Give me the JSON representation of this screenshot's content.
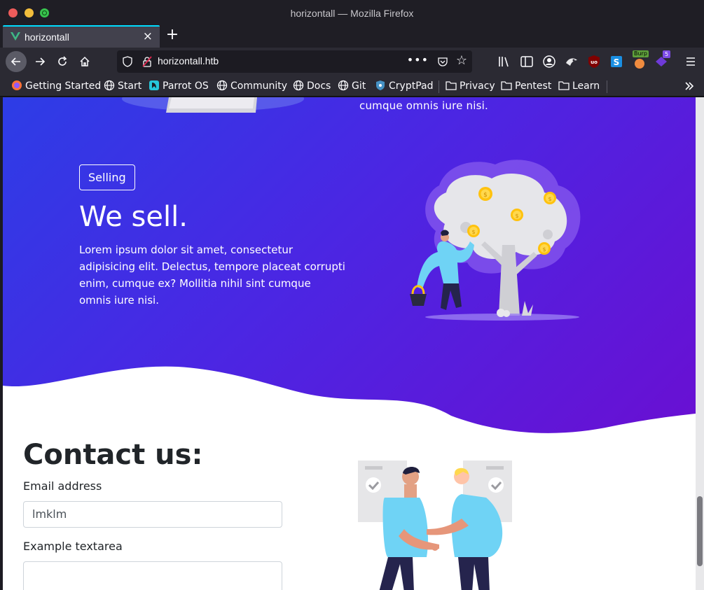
{
  "window": {
    "title": "horizontall — Mozilla Firefox"
  },
  "tab": {
    "label": "horizontall",
    "close": "×",
    "new_tab": "+"
  },
  "navbar": {
    "url": "horizontall.htb",
    "more": "•••"
  },
  "toolbar": {
    "burp_label": "Burp",
    "extension_badge": "5"
  },
  "bookmarks": [
    {
      "label": "Getting Started"
    },
    {
      "label": "Start"
    },
    {
      "label": "Parrot OS"
    },
    {
      "label": "Community"
    },
    {
      "label": "Docs"
    },
    {
      "label": "Git"
    },
    {
      "label": "CryptPad"
    },
    {
      "label": "Privacy"
    },
    {
      "label": "Pentest"
    },
    {
      "label": "Learn"
    }
  ],
  "page": {
    "prev_section_tail": "cumque omnis iure nisi.",
    "selling": {
      "badge": "Selling",
      "heading": "We sell.",
      "body": "Lorem ipsum dolor sit amet, consectetur adipisicing elit. Delectus, tempore placeat corrupti enim, cumque ex? Mollitia nihil sint cumque omnis iure nisi."
    },
    "contact": {
      "heading": "Contact us:",
      "email_label": "Email address",
      "email_value": "lmklm",
      "textarea_label": "Example textarea"
    }
  },
  "colors": {
    "hero_start": "#2d3de6",
    "hero_end": "#6a0fd2",
    "tab_accent": "#00ddff"
  }
}
